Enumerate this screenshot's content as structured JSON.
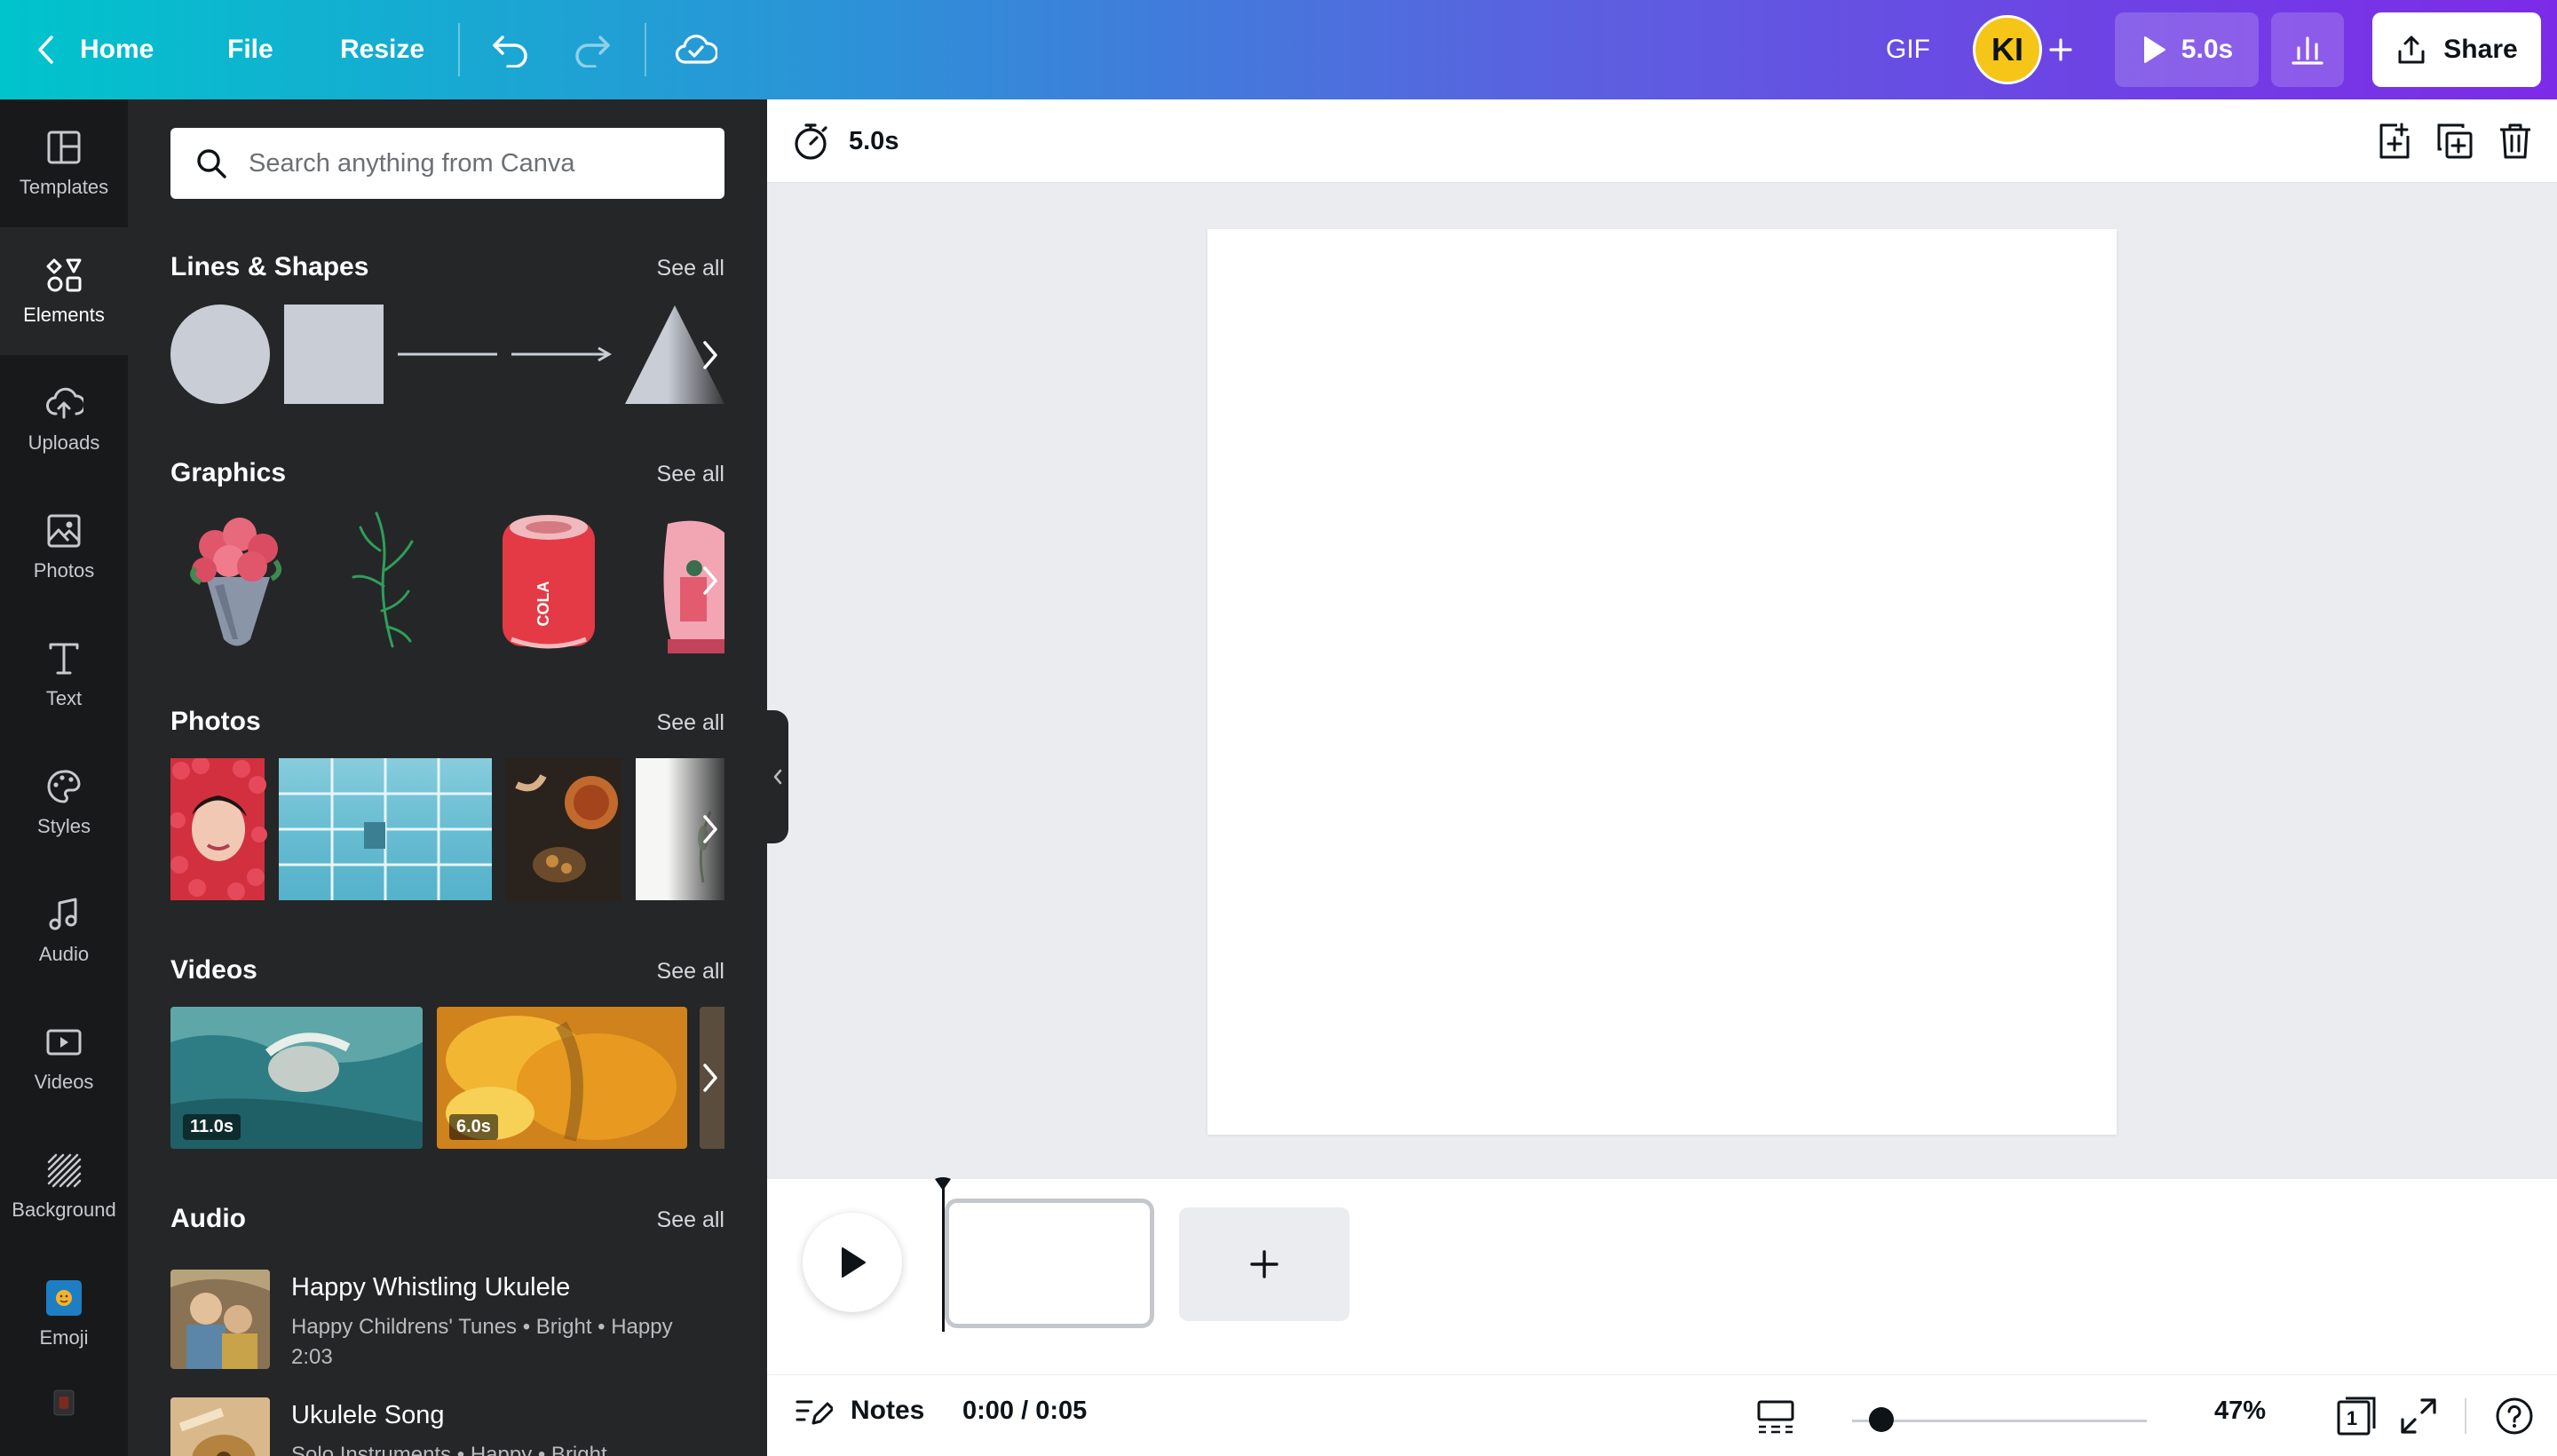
{
  "topbar": {
    "home_label": "Home",
    "file_label": "File",
    "resize_label": "Resize",
    "format_label": "GIF",
    "avatar_initials": "KI",
    "play_duration": "5.0s",
    "share_label": "Share",
    "gradient_colors": [
      "#00c4cc",
      "#5c5fe0",
      "#7d2ae8"
    ]
  },
  "rail": {
    "items": [
      {
        "label": "Templates",
        "icon": "templates-icon"
      },
      {
        "label": "Elements",
        "icon": "elements-icon"
      },
      {
        "label": "Uploads",
        "icon": "upload-cloud-icon"
      },
      {
        "label": "Photos",
        "icon": "photo-icon"
      },
      {
        "label": "Text",
        "icon": "text-icon"
      },
      {
        "label": "Styles",
        "icon": "palette-icon"
      },
      {
        "label": "Audio",
        "icon": "music-note-icon"
      },
      {
        "label": "Videos",
        "icon": "video-icon"
      },
      {
        "label": "Background",
        "icon": "background-hatch-icon"
      },
      {
        "label": "Emoji",
        "icon": "emoji-icon"
      }
    ],
    "active": "Elements"
  },
  "panel": {
    "search_placeholder": "Search anything from Canva",
    "sections": {
      "lines_shapes": {
        "title": "Lines & Shapes",
        "see_all": "See all"
      },
      "graphics": {
        "title": "Graphics",
        "see_all": "See all"
      },
      "photos": {
        "title": "Photos",
        "see_all": "See all"
      },
      "videos": {
        "title": "Videos",
        "see_all": "See all",
        "durations": [
          "11.0s",
          "6.0s"
        ]
      },
      "audio": {
        "title": "Audio",
        "see_all": "See all",
        "tracks": [
          {
            "title": "Happy Whistling Ukulele",
            "meta": "Happy Childrens' Tunes • Bright • Happy",
            "duration": "2:03"
          },
          {
            "title": "Ukulele Song",
            "meta": "Solo Instruments • Happy • Bright",
            "duration": ""
          }
        ]
      }
    }
  },
  "canvas": {
    "page_duration": "5.0s"
  },
  "footer": {
    "notes_label": "Notes",
    "timecode": "0:00 / 0:05",
    "zoom": "47%",
    "zoom_fraction": 0.1,
    "page_count": "1"
  }
}
